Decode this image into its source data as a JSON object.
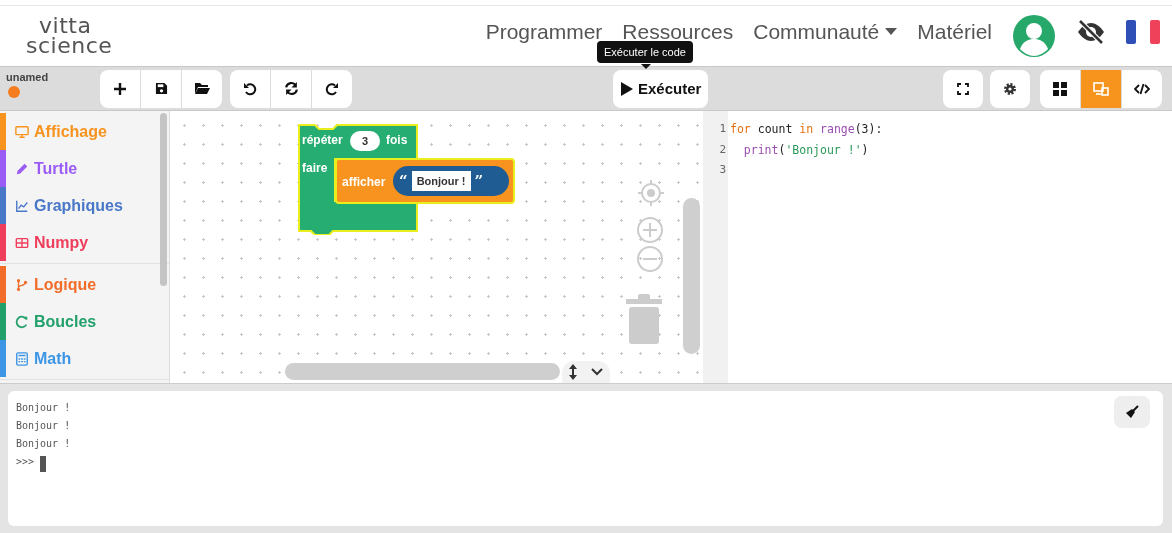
{
  "header": {
    "logo": {
      "top": "vitta",
      "bottom": "science"
    },
    "nav": [
      {
        "label": "Programmer",
        "dropdown": false
      },
      {
        "label": "Ressources",
        "dropdown": false
      },
      {
        "label": "Communauté",
        "dropdown": true
      },
      {
        "label": "Matériel",
        "dropdown": false
      }
    ]
  },
  "tooltip": {
    "text": "Exécuter le code"
  },
  "toolbar": {
    "project_name": "unamed",
    "run_button": {
      "label": "Exécuter"
    },
    "view_modes": [
      {
        "selected": false
      },
      {
        "selected": true
      },
      {
        "selected": false
      }
    ]
  },
  "sidebar": {
    "groups": [
      {
        "items": [
          {
            "label": "Affichage",
            "color": "#f7931e"
          },
          {
            "label": "Turtle",
            "color": "#9b5cf6"
          },
          {
            "label": "Graphiques",
            "color": "#4a78c9"
          },
          {
            "label": "Numpy",
            "color": "#ef3e5c"
          }
        ]
      },
      {
        "items": [
          {
            "label": "Logique",
            "color": "#f26d2a"
          },
          {
            "label": "Boucles",
            "color": "#22a06b"
          },
          {
            "label": "Math",
            "color": "#3d95e6"
          }
        ]
      }
    ]
  },
  "workspace": {
    "repeat_block": {
      "label": "répéter",
      "count": "3",
      "suffix": "fois",
      "do_label": "faire",
      "body": {
        "label": "afficher",
        "open_quote": "“",
        "text": "Bonjour !",
        "close_quote": "”"
      }
    }
  },
  "code_editor": {
    "lines": [
      {
        "number": "1",
        "tokens": [
          {
            "kind": "keyword",
            "text": "for"
          },
          {
            "kind": "plain",
            "text": " count "
          },
          {
            "kind": "keyword",
            "text": "in"
          },
          {
            "kind": "builtin",
            "text": " range"
          },
          {
            "kind": "plain",
            "text": "(3):"
          }
        ]
      },
      {
        "number": "2",
        "tokens": [
          {
            "kind": "builtin",
            "text": "  print"
          },
          {
            "kind": "plain",
            "text": "("
          },
          {
            "kind": "string",
            "text": "'Bonjour !'"
          },
          {
            "kind": "plain",
            "text": ")"
          }
        ]
      },
      {
        "number": "3"
      }
    ]
  },
  "console": {
    "lines": [
      "Bonjour !",
      "Bonjour !",
      "Bonjour !"
    ],
    "prompt": ">>>"
  }
}
